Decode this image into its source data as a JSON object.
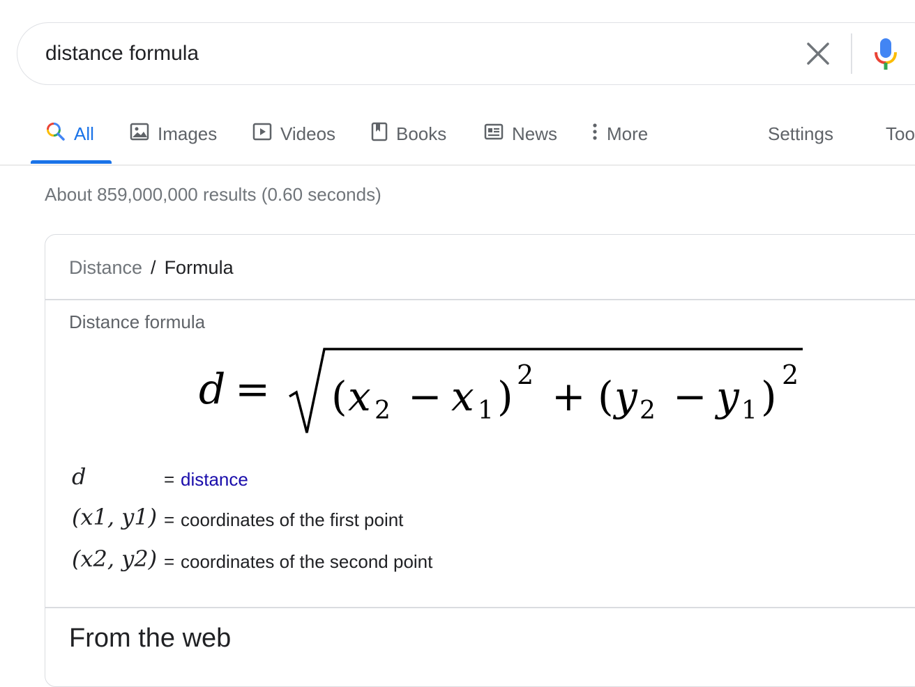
{
  "search": {
    "query": "distance formula",
    "clear_icon": "close-icon",
    "mic_icon": "microphone-icon"
  },
  "tabs": [
    {
      "label": "All",
      "icon": "search-icon",
      "active": true
    },
    {
      "label": "Images",
      "icon": "image-icon"
    },
    {
      "label": "Videos",
      "icon": "play-icon"
    },
    {
      "label": "Books",
      "icon": "book-icon"
    },
    {
      "label": "News",
      "icon": "news-icon"
    },
    {
      "label": "More",
      "icon": "more-vert-icon"
    }
  ],
  "settings_label": "Settings",
  "tools_label": "Tools",
  "result_stats": "About 859,000,000 results (0.60 seconds)",
  "card": {
    "breadcrumb": [
      "Distance",
      "Formula"
    ],
    "breadcrumb_sep": "/",
    "formula_label": "Distance formula",
    "legend": [
      {
        "symbol": "d",
        "equals": "=",
        "description": "distance"
      },
      {
        "symbol": "(x1, y1)",
        "equals": "=",
        "description": "coordinates of the first point"
      },
      {
        "symbol": "(x2, y2)",
        "equals": "=",
        "description": "coordinates of the second point"
      }
    ],
    "web_heading": "From the web"
  },
  "colors": {
    "accent": "#1a73e8",
    "link": "#1a0dab",
    "muted": "#70757a",
    "border": "#dadce0"
  }
}
